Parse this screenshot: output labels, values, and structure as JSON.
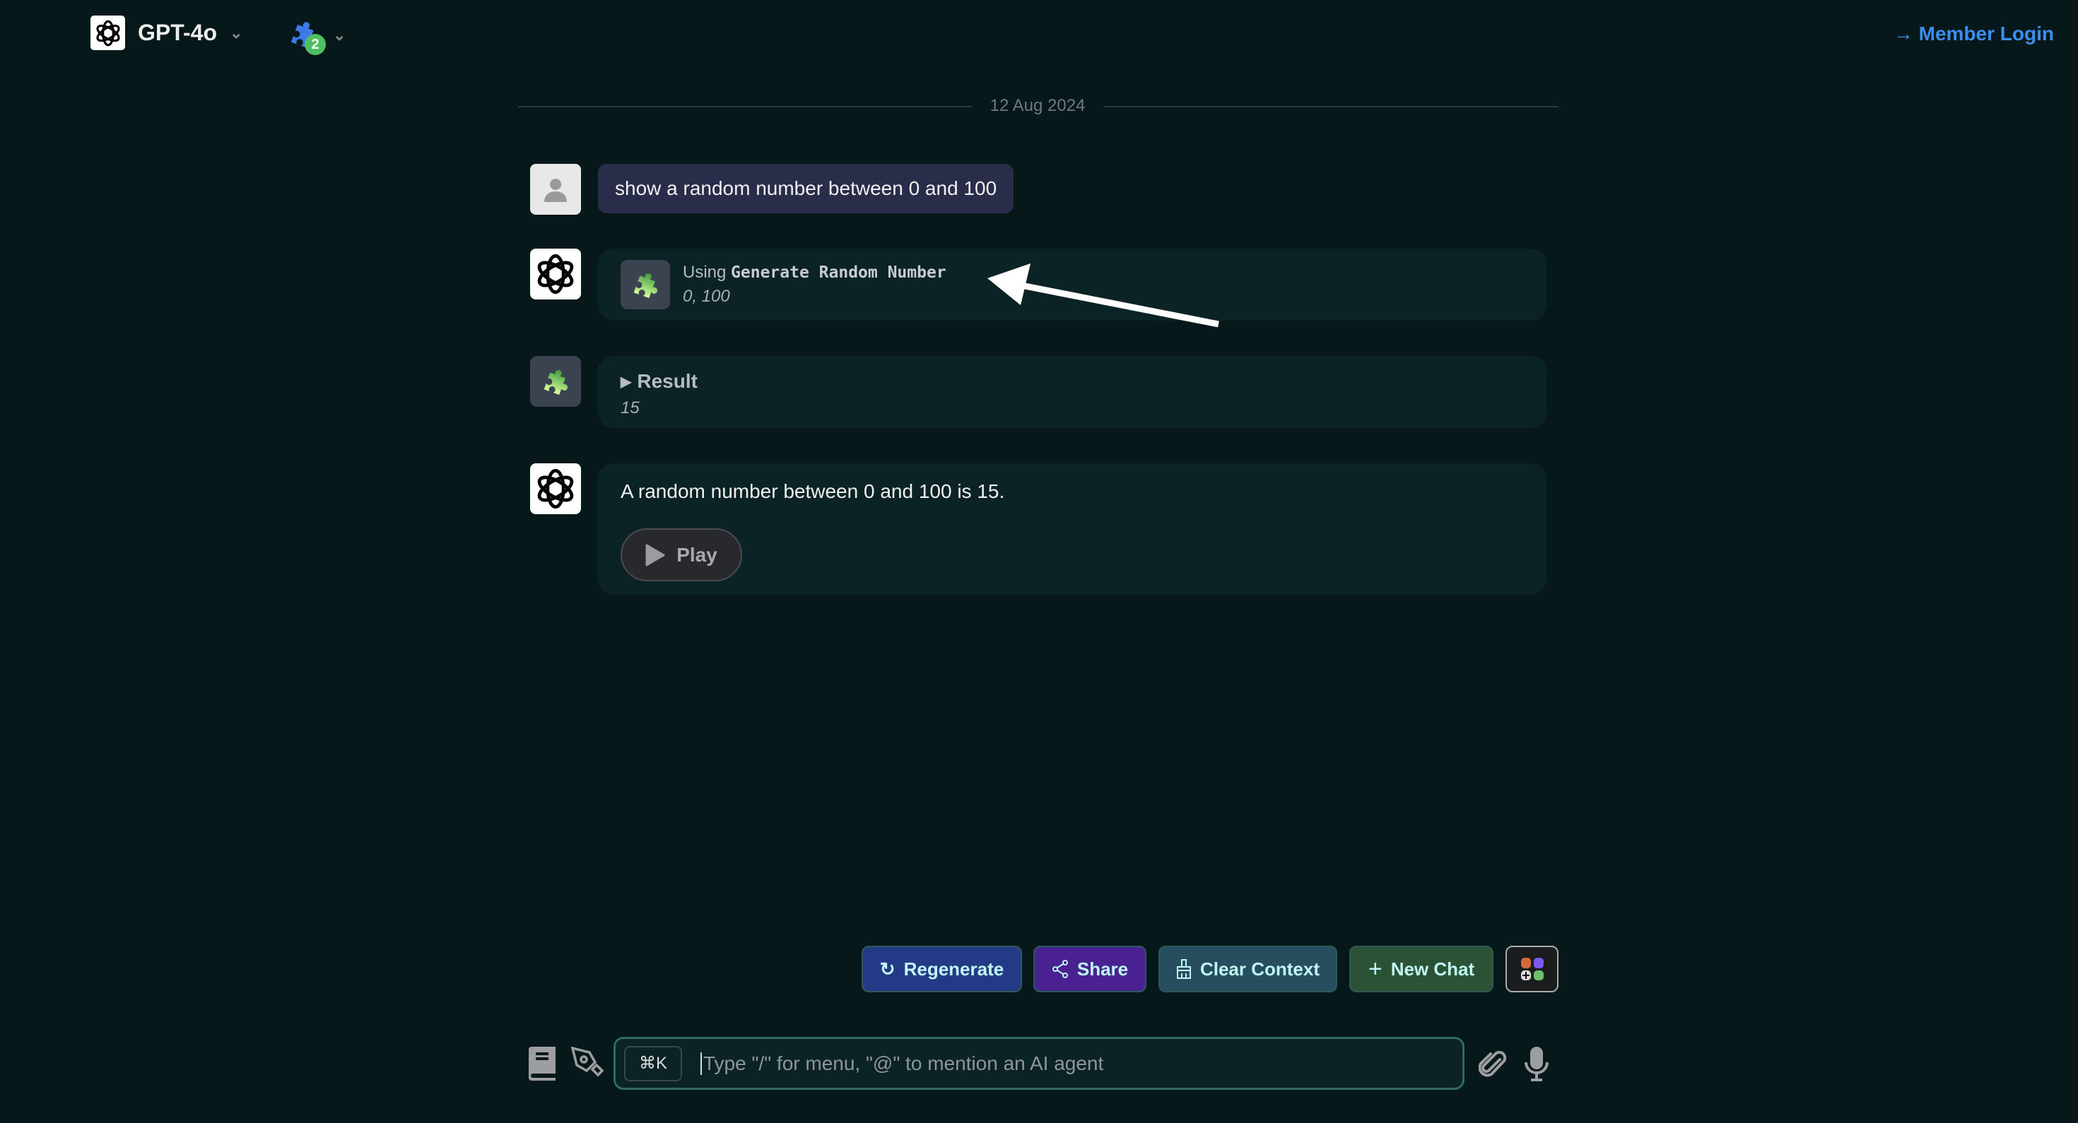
{
  "header": {
    "model": "GPT-4o",
    "plugin_count": "2",
    "login": "→ Member Login"
  },
  "date": "12 Aug 2024",
  "messages": {
    "user": "show a random number between 0 and 100",
    "tool_call": {
      "prefix": "Using",
      "tool": "Generate Random Number",
      "args": "0, 100"
    },
    "result": {
      "label": "Result",
      "value": "15"
    },
    "answer": "A random number between 0 and 100 is 15.",
    "play": "Play"
  },
  "actions": {
    "regenerate": "Regenerate",
    "share": "Share",
    "clear": "Clear Context",
    "new_chat": "New Chat"
  },
  "input": {
    "shortcut": "⌘K",
    "placeholder": "Type \"/\" for menu, \"@\" to mention an AI agent"
  },
  "colors": {
    "regenerate": "#253a86",
    "share": "#4a2190",
    "clear": "#274e5e",
    "new_chat": "#2b5234",
    "link": "#3b8ef0"
  }
}
